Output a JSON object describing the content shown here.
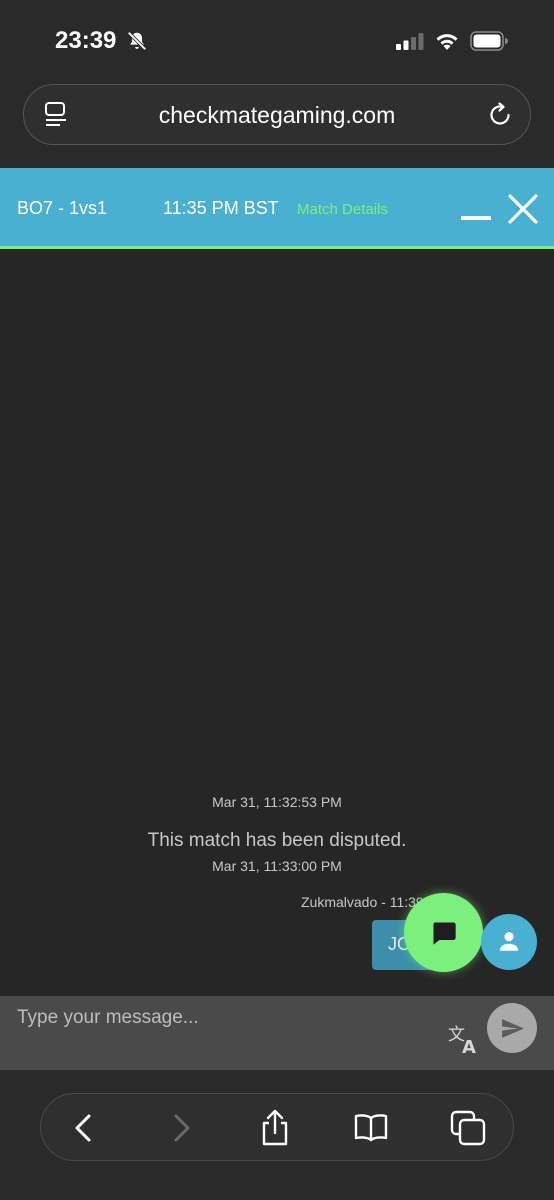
{
  "status_bar": {
    "time": "23:39",
    "icons": [
      "bell-slash-icon",
      "cellular-signal-icon",
      "wifi-icon",
      "battery-icon"
    ]
  },
  "browser": {
    "url": "checkmategaming.com",
    "icons": [
      "reader-mode-icon",
      "reload-icon"
    ]
  },
  "chat_header": {
    "mode": "BO7 - 1vs1",
    "time": "11:35 PM BST",
    "details_link": "Match Details",
    "accent_color": "#4ab0d2",
    "highlight_color": "#7cf07c"
  },
  "messages": {
    "timestamp_1": "Mar 31, 11:32:53 PM",
    "system_message": "This match has been disputed.",
    "timestamp_2": "Mar 31, 11:33:00 PM",
    "author": "Zukmalvado - 11:39 PM",
    "bubble_text": "JO"
  },
  "composer": {
    "placeholder": "Type your message...",
    "icons": [
      "translate-icon",
      "send-icon"
    ]
  },
  "toolbar": {
    "icons": [
      "back-icon",
      "forward-icon",
      "share-icon",
      "bookmarks-icon",
      "tabs-icon"
    ]
  }
}
